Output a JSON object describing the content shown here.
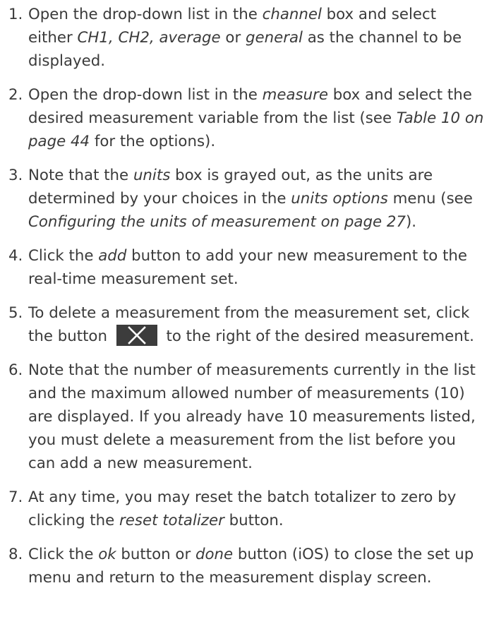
{
  "steps": [
    {
      "num": "1.",
      "parts": [
        {
          "t": "Open the drop-down list in the "
        },
        {
          "t": "channel",
          "i": true
        },
        {
          "t": " box and select either "
        },
        {
          "t": "CH1, CH2, average",
          "i": true
        },
        {
          "t": " or "
        },
        {
          "t": "general",
          "i": true
        },
        {
          "t": " as the channel to be displayed."
        }
      ]
    },
    {
      "num": "2.",
      "parts": [
        {
          "t": "Open the drop-down list in the "
        },
        {
          "t": "measure",
          "i": true
        },
        {
          "t": " box and select the desired measurement variable from the list (see "
        },
        {
          "t": "Table 10 on page 44",
          "i": true
        },
        {
          "t": " for the options)."
        }
      ]
    },
    {
      "num": "3.",
      "parts": [
        {
          "t": "Note that the "
        },
        {
          "t": "units",
          "i": true
        },
        {
          "t": " box is grayed out, as the units are determined by your choices in the "
        },
        {
          "t": "units options",
          "i": true
        },
        {
          "t": " menu (see "
        },
        {
          "t": "Configuring the units of measurement on page 27",
          "i": true
        },
        {
          "t": ")."
        }
      ]
    },
    {
      "num": "4.",
      "parts": [
        {
          "t": "Click the "
        },
        {
          "t": "add",
          "i": true
        },
        {
          "t": " button to add your new measurement to the real-time measurement set."
        }
      ]
    },
    {
      "num": "5.",
      "parts": [
        {
          "t": "To delete a measurement from the measurement set, click the button"
        },
        {
          "icon": "close-x-icon"
        },
        {
          "t": "to the right of the desired measurement."
        }
      ]
    },
    {
      "num": "6.",
      "parts": [
        {
          "t": "Note that the number of measurements currently in the list and the maximum allowed number of measurements (10) are displayed. If you already have 10 measurements listed, you must delete a measurement from the list before you can add a new measurement."
        }
      ]
    },
    {
      "num": "7.",
      "parts": [
        {
          "t": "At any time, you may reset the batch totalizer to zero by clicking the "
        },
        {
          "t": "reset totalizer",
          "i": true
        },
        {
          "t": " button."
        }
      ]
    },
    {
      "num": "8.",
      "parts": [
        {
          "t": "Click the "
        },
        {
          "t": "ok",
          "i": true
        },
        {
          "t": " button or "
        },
        {
          "t": "done",
          "i": true
        },
        {
          "t": " button (iOS) to close the set up menu and return to the measurement display screen."
        }
      ]
    }
  ],
  "colors": {
    "text": "#3a3a3a",
    "icon_bg": "#3c3c3c",
    "icon_fg": "#ffffff"
  }
}
